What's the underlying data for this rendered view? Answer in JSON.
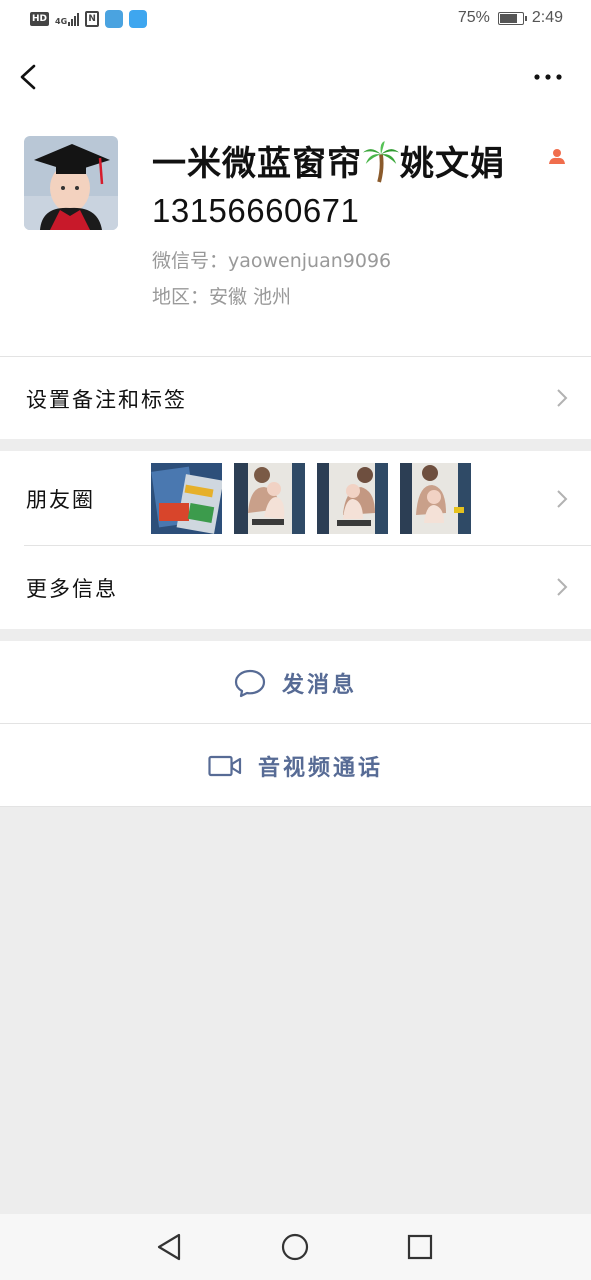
{
  "status_bar": {
    "hd": "HD",
    "network": "4G",
    "battery_text": "75%",
    "battery_level": 0.75,
    "time": "2:49"
  },
  "header": {
    "back_icon": "chevron-left-icon",
    "more_icon": "more-dots-icon"
  },
  "profile": {
    "name_part1": "一米微蓝窗帘",
    "name_emoji": "palm-tree-icon",
    "name_part2": "姚文娟",
    "phone": "13156660671",
    "wechat_id": "微信号：yaowenjuan9096",
    "region": "地区：安徽  池州",
    "gender_icon": "person-icon",
    "accent_color": "#f06d4c"
  },
  "rows": {
    "remark_label": "设置备注和标签",
    "moments_label": "朋友圈",
    "more_info_label": "更多信息"
  },
  "actions": {
    "message_label": "发消息",
    "call_label": "音视频通话",
    "link_color": "#576b95"
  },
  "navbar": {
    "back_icon": "nav-back-icon",
    "home_icon": "nav-home-icon",
    "recents_icon": "nav-recents-icon"
  }
}
